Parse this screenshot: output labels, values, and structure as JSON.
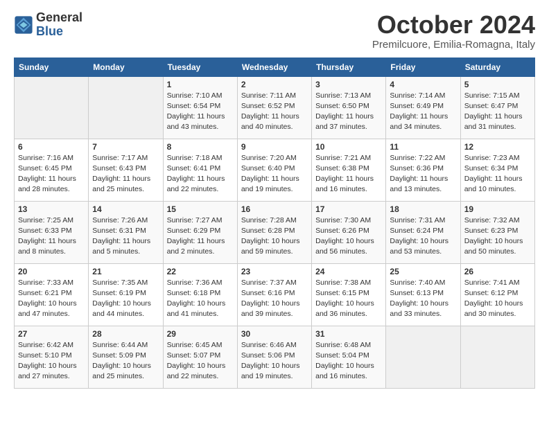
{
  "logo": {
    "general": "General",
    "blue": "Blue"
  },
  "title": "October 2024",
  "location": "Premilcuore, Emilia-Romagna, Italy",
  "weekdays": [
    "Sunday",
    "Monday",
    "Tuesday",
    "Wednesday",
    "Thursday",
    "Friday",
    "Saturday"
  ],
  "weeks": [
    [
      {
        "day": "",
        "info": ""
      },
      {
        "day": "",
        "info": ""
      },
      {
        "day": "1",
        "info": "Sunrise: 7:10 AM\nSunset: 6:54 PM\nDaylight: 11 hours and 43 minutes."
      },
      {
        "day": "2",
        "info": "Sunrise: 7:11 AM\nSunset: 6:52 PM\nDaylight: 11 hours and 40 minutes."
      },
      {
        "day": "3",
        "info": "Sunrise: 7:13 AM\nSunset: 6:50 PM\nDaylight: 11 hours and 37 minutes."
      },
      {
        "day": "4",
        "info": "Sunrise: 7:14 AM\nSunset: 6:49 PM\nDaylight: 11 hours and 34 minutes."
      },
      {
        "day": "5",
        "info": "Sunrise: 7:15 AM\nSunset: 6:47 PM\nDaylight: 11 hours and 31 minutes."
      }
    ],
    [
      {
        "day": "6",
        "info": "Sunrise: 7:16 AM\nSunset: 6:45 PM\nDaylight: 11 hours and 28 minutes."
      },
      {
        "day": "7",
        "info": "Sunrise: 7:17 AM\nSunset: 6:43 PM\nDaylight: 11 hours and 25 minutes."
      },
      {
        "day": "8",
        "info": "Sunrise: 7:18 AM\nSunset: 6:41 PM\nDaylight: 11 hours and 22 minutes."
      },
      {
        "day": "9",
        "info": "Sunrise: 7:20 AM\nSunset: 6:40 PM\nDaylight: 11 hours and 19 minutes."
      },
      {
        "day": "10",
        "info": "Sunrise: 7:21 AM\nSunset: 6:38 PM\nDaylight: 11 hours and 16 minutes."
      },
      {
        "day": "11",
        "info": "Sunrise: 7:22 AM\nSunset: 6:36 PM\nDaylight: 11 hours and 13 minutes."
      },
      {
        "day": "12",
        "info": "Sunrise: 7:23 AM\nSunset: 6:34 PM\nDaylight: 11 hours and 10 minutes."
      }
    ],
    [
      {
        "day": "13",
        "info": "Sunrise: 7:25 AM\nSunset: 6:33 PM\nDaylight: 11 hours and 8 minutes."
      },
      {
        "day": "14",
        "info": "Sunrise: 7:26 AM\nSunset: 6:31 PM\nDaylight: 11 hours and 5 minutes."
      },
      {
        "day": "15",
        "info": "Sunrise: 7:27 AM\nSunset: 6:29 PM\nDaylight: 11 hours and 2 minutes."
      },
      {
        "day": "16",
        "info": "Sunrise: 7:28 AM\nSunset: 6:28 PM\nDaylight: 10 hours and 59 minutes."
      },
      {
        "day": "17",
        "info": "Sunrise: 7:30 AM\nSunset: 6:26 PM\nDaylight: 10 hours and 56 minutes."
      },
      {
        "day": "18",
        "info": "Sunrise: 7:31 AM\nSunset: 6:24 PM\nDaylight: 10 hours and 53 minutes."
      },
      {
        "day": "19",
        "info": "Sunrise: 7:32 AM\nSunset: 6:23 PM\nDaylight: 10 hours and 50 minutes."
      }
    ],
    [
      {
        "day": "20",
        "info": "Sunrise: 7:33 AM\nSunset: 6:21 PM\nDaylight: 10 hours and 47 minutes."
      },
      {
        "day": "21",
        "info": "Sunrise: 7:35 AM\nSunset: 6:19 PM\nDaylight: 10 hours and 44 minutes."
      },
      {
        "day": "22",
        "info": "Sunrise: 7:36 AM\nSunset: 6:18 PM\nDaylight: 10 hours and 41 minutes."
      },
      {
        "day": "23",
        "info": "Sunrise: 7:37 AM\nSunset: 6:16 PM\nDaylight: 10 hours and 39 minutes."
      },
      {
        "day": "24",
        "info": "Sunrise: 7:38 AM\nSunset: 6:15 PM\nDaylight: 10 hours and 36 minutes."
      },
      {
        "day": "25",
        "info": "Sunrise: 7:40 AM\nSunset: 6:13 PM\nDaylight: 10 hours and 33 minutes."
      },
      {
        "day": "26",
        "info": "Sunrise: 7:41 AM\nSunset: 6:12 PM\nDaylight: 10 hours and 30 minutes."
      }
    ],
    [
      {
        "day": "27",
        "info": "Sunrise: 6:42 AM\nSunset: 5:10 PM\nDaylight: 10 hours and 27 minutes."
      },
      {
        "day": "28",
        "info": "Sunrise: 6:44 AM\nSunset: 5:09 PM\nDaylight: 10 hours and 25 minutes."
      },
      {
        "day": "29",
        "info": "Sunrise: 6:45 AM\nSunset: 5:07 PM\nDaylight: 10 hours and 22 minutes."
      },
      {
        "day": "30",
        "info": "Sunrise: 6:46 AM\nSunset: 5:06 PM\nDaylight: 10 hours and 19 minutes."
      },
      {
        "day": "31",
        "info": "Sunrise: 6:48 AM\nSunset: 5:04 PM\nDaylight: 10 hours and 16 minutes."
      },
      {
        "day": "",
        "info": ""
      },
      {
        "day": "",
        "info": ""
      }
    ]
  ]
}
